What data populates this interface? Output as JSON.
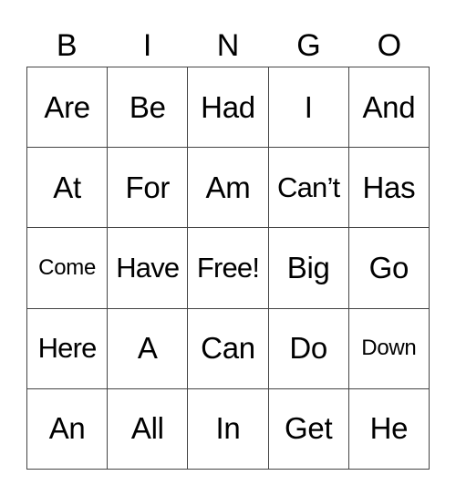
{
  "header": [
    "B",
    "I",
    "N",
    "G",
    "O"
  ],
  "rows": [
    [
      "Are",
      "Be",
      "Had",
      "I",
      "And"
    ],
    [
      "At",
      "For",
      "Am",
      "Can’t",
      "Has"
    ],
    [
      "Come",
      "Have",
      "Free!",
      "Big",
      "Go"
    ],
    [
      "Here",
      "A",
      "Can",
      "Do",
      "Down"
    ],
    [
      "An",
      "All",
      "In",
      "Get",
      "He"
    ]
  ]
}
